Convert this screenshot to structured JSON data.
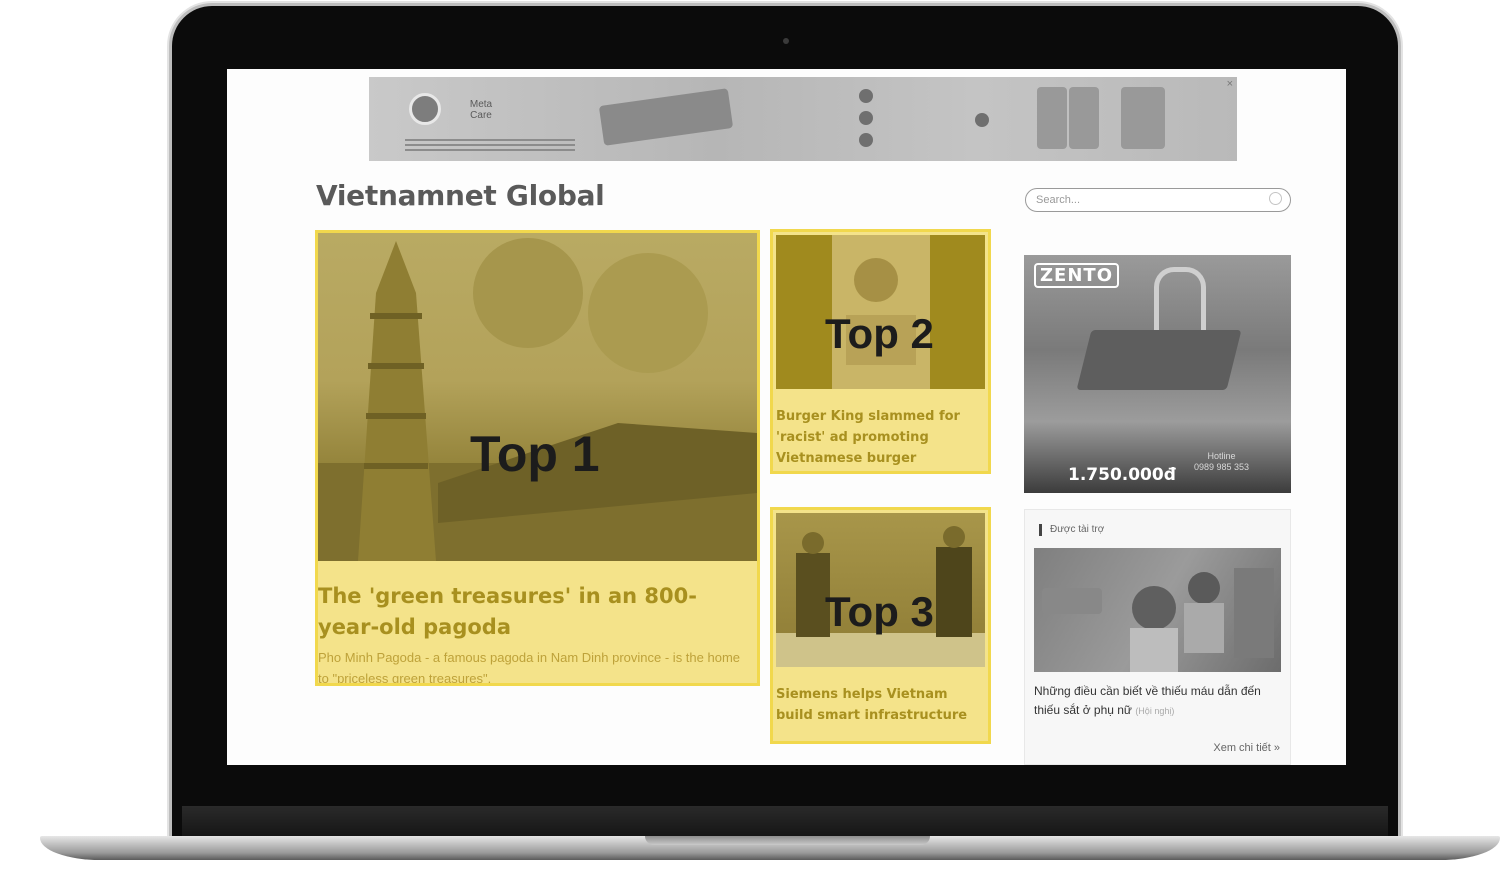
{
  "ad_banner": {
    "brand": "Meta Care",
    "close": "×"
  },
  "site": {
    "title": "Vietnamnet Global"
  },
  "search": {
    "placeholder": "Search..."
  },
  "articles": [
    {
      "rank_label": "Top 1",
      "headline": "The 'green treasures' in an 800-year-old pagoda",
      "sapo": "Pho Minh Pagoda - a famous pagoda in Nam Dinh province - is the home to \"priceless green treasures\"."
    },
    {
      "rank_label": "Top 2",
      "headline": "Burger King slammed for 'racist' ad promoting Vietnamese burger"
    },
    {
      "rank_label": "Top 3",
      "headline": "Siemens helps Vietnam build smart infrastructure"
    }
  ],
  "right_ad": {
    "brand": "ZENTO",
    "price": "1.750.000đ",
    "hotline_label": "Hotline",
    "hotline_number": "0989 985 353"
  },
  "sponsored": {
    "label": "Được tài trợ",
    "title": "Những điều cần biết về thiếu máu dẫn đến thiếu sắt ở phụ nữ",
    "source": "(Hội nghị)",
    "view_more": "Xem chi tiết »"
  },
  "colors": {
    "highlight_fill": "#f4e38a",
    "highlight_border": "#f1d84d",
    "headline_text": "#a8901f"
  }
}
